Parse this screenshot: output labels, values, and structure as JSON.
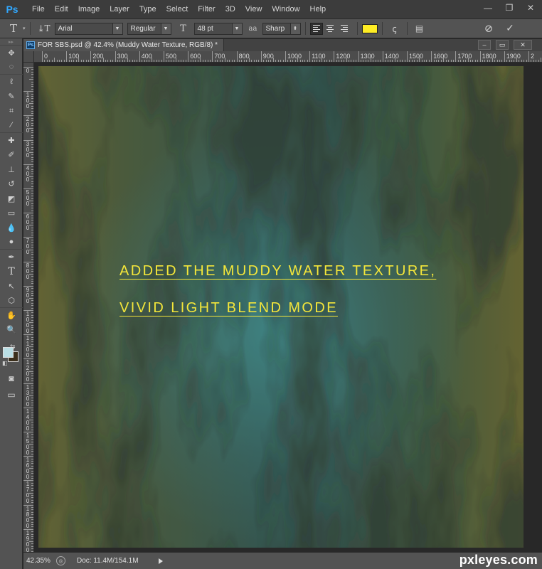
{
  "app": {
    "logo": "Ps"
  },
  "menu": [
    "File",
    "Edit",
    "Image",
    "Layer",
    "Type",
    "Select",
    "Filter",
    "3D",
    "View",
    "Window",
    "Help"
  ],
  "window_controls": {
    "minimize": "—",
    "restore": "❐",
    "close": "✕"
  },
  "options_bar": {
    "tool_glyph": "T",
    "orient_glyph": "⤓T",
    "font_family": "Arial",
    "font_style": "Regular",
    "size_glyph": "T",
    "font_size": "48 pt",
    "aa_glyph": "aa",
    "anti_alias": "Sharp",
    "text_color": "#ffed24",
    "cancel_glyph": "⊘",
    "commit_glyph": "✓"
  },
  "document": {
    "tab_title": "FOR SBS.psd @ 42.4% (Muddy Water Texture, RGB/8) *",
    "ps_mini": "Ps",
    "controls": {
      "minimize": "–",
      "restore": "▭",
      "close": "✕"
    }
  },
  "ruler": {
    "h_labels": [
      "0",
      "100",
      "200",
      "300",
      "400",
      "500",
      "600",
      "700",
      "800",
      "900",
      "1000",
      "1100",
      "1200",
      "1300",
      "1400",
      "1500",
      "1600",
      "1700",
      "1800",
      "1900",
      "2"
    ],
    "v_labels": [
      "0",
      "1\n0\n0",
      "2\n0\n0",
      "3\n0\n0",
      "4\n0\n0",
      "5\n0\n0",
      "6\n0\n0",
      "7\n0\n0",
      "8\n0\n0",
      "9\n0\n0",
      "1\n0\n0\n0",
      "1\n1\n0\n0",
      "1\n2\n0\n0",
      "1\n3\n0\n0",
      "1\n4\n0\n0",
      "1\n5\n0\n0",
      "1\n6\n0\n0",
      "1\n7\n0\n0",
      "1\n8\n0\n0",
      "1\n9\n0\n0"
    ]
  },
  "canvas": {
    "line1": "ADDED THE MUDDY WATER TEXTURE,",
    "line2": "VIVID LIGHT BLEND MODE"
  },
  "tools": [
    {
      "name": "move-tool-icon",
      "glyph": "✥"
    },
    {
      "name": "marquee-tool-icon",
      "glyph": "◌"
    },
    {
      "name": "lasso-tool-icon",
      "glyph": "ℓ"
    },
    {
      "name": "quick-select-tool-icon",
      "glyph": "✎"
    },
    {
      "name": "crop-tool-icon",
      "glyph": "⌗"
    },
    {
      "name": "eyedropper-tool-icon",
      "glyph": "⁄"
    },
    {
      "name": "healing-brush-tool-icon",
      "glyph": "✚"
    },
    {
      "name": "brush-tool-icon",
      "glyph": "✐"
    },
    {
      "name": "clone-stamp-tool-icon",
      "glyph": "⊥"
    },
    {
      "name": "history-brush-tool-icon",
      "glyph": "↺"
    },
    {
      "name": "eraser-tool-icon",
      "glyph": "◩"
    },
    {
      "name": "gradient-tool-icon",
      "glyph": "▭"
    },
    {
      "name": "blur-tool-icon",
      "glyph": "💧"
    },
    {
      "name": "dodge-tool-icon",
      "glyph": "●"
    },
    {
      "name": "pen-tool-icon",
      "glyph": "✒"
    },
    {
      "name": "type-tool-icon",
      "glyph": "T"
    },
    {
      "name": "path-select-tool-icon",
      "glyph": "↖"
    },
    {
      "name": "shape-tool-icon",
      "glyph": "⬡"
    },
    {
      "name": "hand-tool-icon",
      "glyph": "✋"
    },
    {
      "name": "zoom-tool-icon",
      "glyph": "🔍"
    }
  ],
  "colors": {
    "foreground": "#b9dee4",
    "background": "#3b2f1c"
  },
  "status": {
    "zoom": "42.35%",
    "doc_info": "Doc: 11.4M/154.1M"
  },
  "watermark": "pxleyes.com"
}
